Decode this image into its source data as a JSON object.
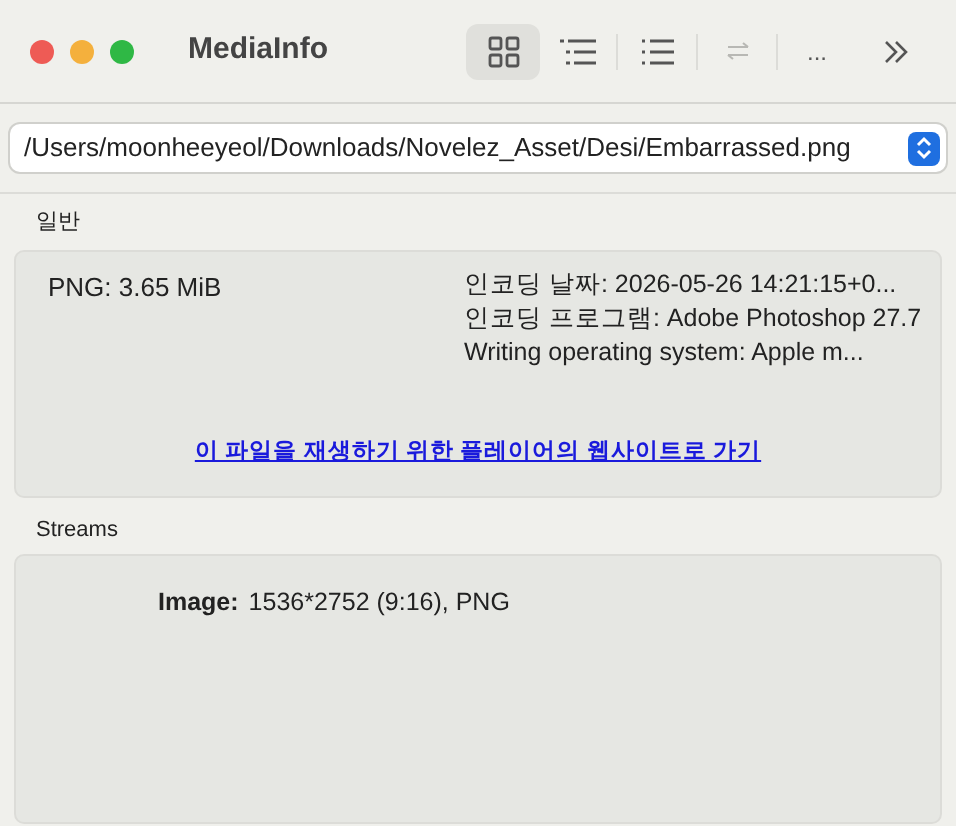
{
  "window": {
    "title": "MediaInfo"
  },
  "toolbar": [
    {
      "kind": "grid",
      "selected": true,
      "disabled": false
    },
    {
      "kind": "tree",
      "selected": false,
      "disabled": false
    },
    {
      "kind": "list",
      "selected": false,
      "disabled": false
    },
    {
      "kind": "swap",
      "selected": false,
      "disabled": true
    },
    {
      "kind": "more",
      "label": "...",
      "selected": false,
      "disabled": false
    },
    {
      "kind": "overflow",
      "selected": false,
      "disabled": false
    }
  ],
  "file_picker": {
    "value": "/Users/moonheeyeol/Downloads/Novelez_Asset/Desi/Embarrassed.png"
  },
  "general": {
    "title": "일반",
    "format": "PNG: 3.65 MiB",
    "details": [
      "인코딩 날짜: 2026-05-26 14:21:15+0...",
      "인코딩 프로그램: Adobe Photoshop 27.7",
      "Writing operating system: Apple m..."
    ],
    "link": "이 파일을 재생하기 위한 플레이어의 웹사이트로 가기"
  },
  "streams": {
    "title": "Streams",
    "items": [
      {
        "label": "Image:",
        "value": "1536*2752 (9:16), PNG"
      }
    ]
  }
}
